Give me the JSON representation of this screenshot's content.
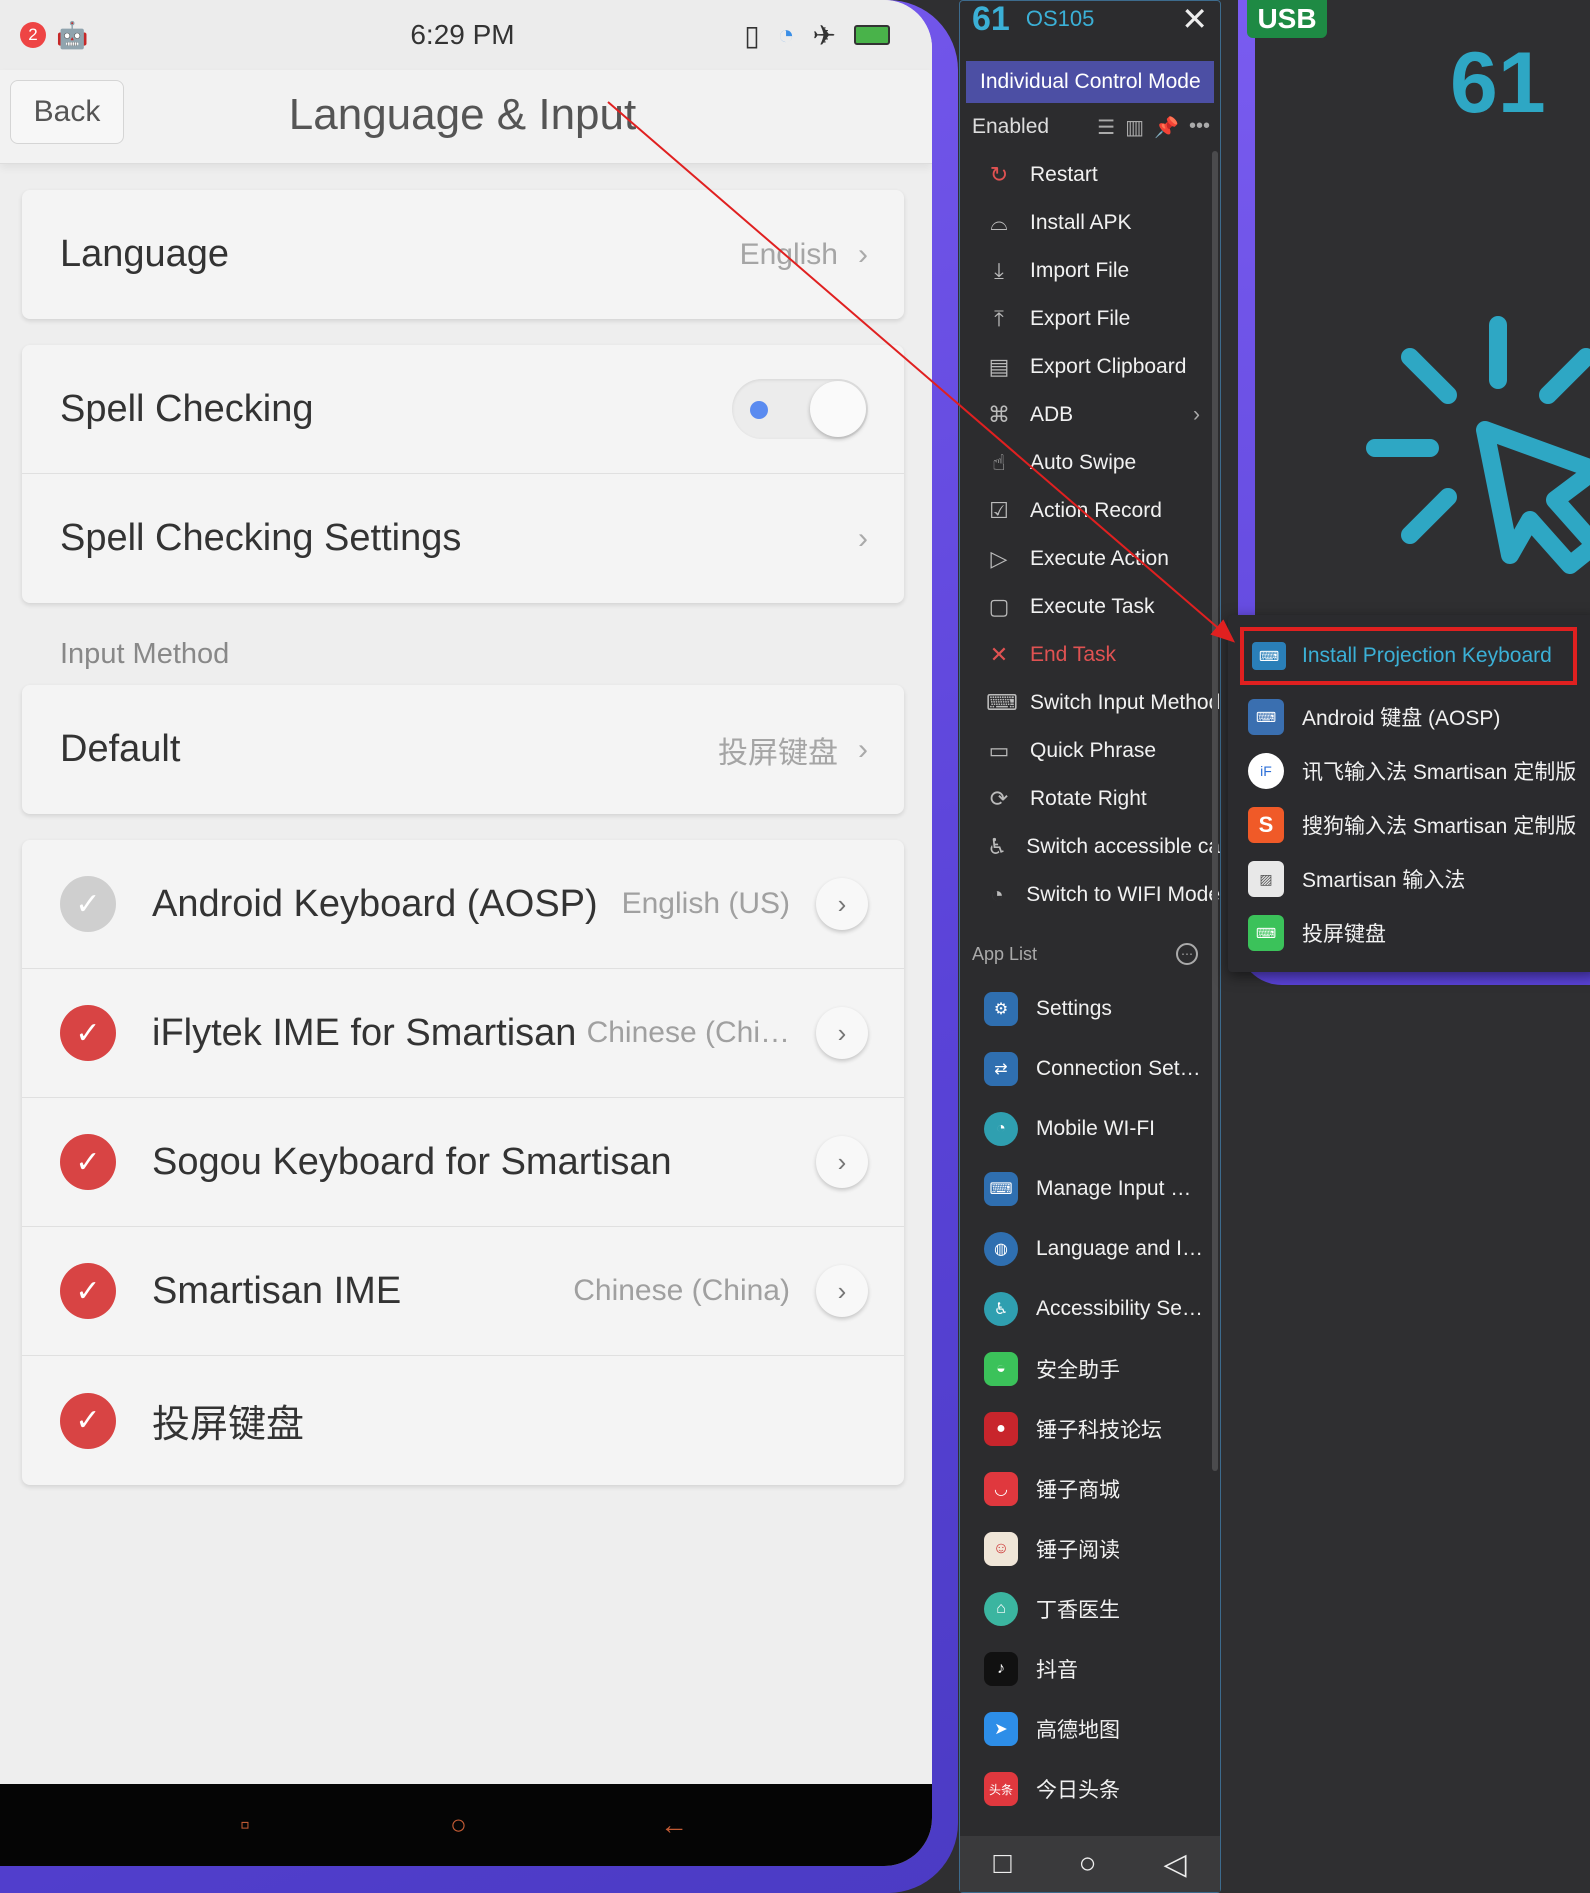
{
  "status": {
    "notif_count": "2",
    "time": "6:29 PM"
  },
  "nav": {
    "back": "Back",
    "title": "Language & Input"
  },
  "settings": {
    "language_label": "Language",
    "language_value": "English",
    "spell_checking": "Spell Checking",
    "spell_checking_on": false,
    "spell_settings": "Spell Checking Settings",
    "section_input": "Input Method",
    "default_label": "Default",
    "default_value": "投屏键盘",
    "imes": [
      {
        "name": "Android Keyboard (AOSP)",
        "lang": "English (US)",
        "checked": false
      },
      {
        "name": "iFlytek IME for Smartisan",
        "lang": "Chinese (Chi…",
        "checked": true
      },
      {
        "name": "Sogou Keyboard for Smartisan",
        "lang": "",
        "checked": true
      },
      {
        "name": "Smartisan IME",
        "lang": "Chinese (China)",
        "checked": true
      },
      {
        "name": "投屏键盘",
        "lang": "",
        "checked": true
      }
    ]
  },
  "sidebar": {
    "device_num": "61",
    "device_id": "OS105",
    "mode": "Individual Control Mode",
    "enabled": "Enabled",
    "menu": [
      "Restart",
      "Install APK",
      "Import File",
      "Export File",
      "Export Clipboard",
      "ADB",
      "Auto Swipe",
      "Action Record",
      "Execute Action",
      "Execute Task",
      "End Task",
      "Switch Input Method",
      "Quick Phrase",
      "Rotate Right",
      "Switch accessible ca",
      "Switch to WIFI Mode"
    ],
    "applist_title": "App List",
    "apps": [
      "Settings",
      "Connection Set…",
      "Mobile WI-FI",
      "Manage Input …",
      "Language and I…",
      "Accessibility Se…",
      "安全助手",
      "锤子科技论坛",
      "锤子商城",
      "锤子阅读",
      "丁香医生",
      "抖音",
      "高德地图",
      "今日头条"
    ]
  },
  "right": {
    "usb": "USB",
    "num": "61"
  },
  "popup": {
    "highlighted": "Install Projection Keyboard",
    "items": [
      "Android 键盘 (AOSP)",
      "讯飞输入法 Smartisan 定制版",
      "搜狗输入法 Smartisan 定制版",
      "Smartisan 输入法",
      "投屏键盘"
    ]
  },
  "colors": {
    "accent": "#3bb0d6",
    "frame": "#5a43d8",
    "danger": "#e05252",
    "check": "#d84444"
  }
}
